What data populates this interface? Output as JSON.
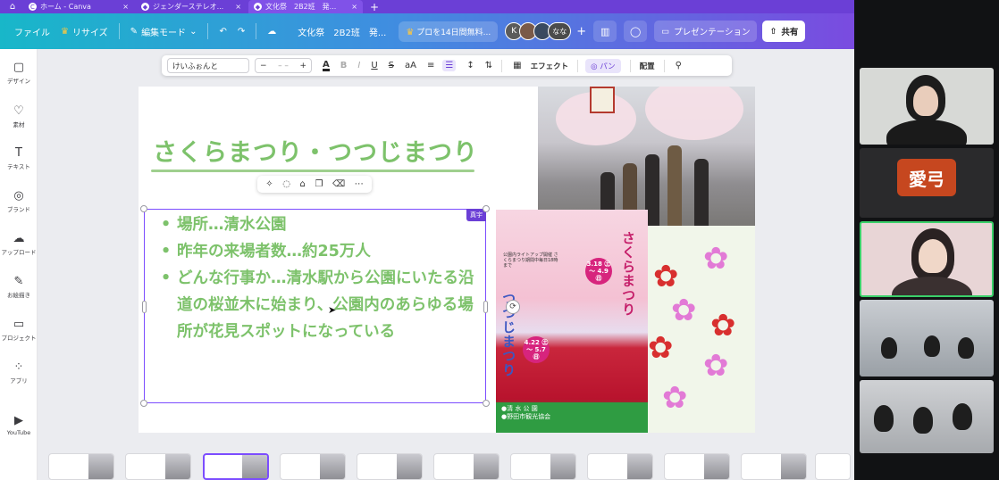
{
  "browser": {
    "tabs": [
      {
        "favicon": "C",
        "title": "ホーム - Canva",
        "active": false
      },
      {
        "favicon": "◆",
        "title": "ジェンダーステレオ...",
        "active": false
      },
      {
        "favicon": "◆",
        "title": "文化祭　2B2班　発...",
        "active": true
      }
    ],
    "new_tab": "+"
  },
  "header": {
    "file": "ファイル",
    "resize": "リサイズ",
    "edit_mode": "編集モード",
    "doc_title": "文化祭　2B2班　発...",
    "promo": "プロを14日間無料...",
    "avatar_k": "K",
    "avatar_nana": "なな",
    "add": "+",
    "presentation": "プレゼンテーション",
    "share": "共有"
  },
  "sidebar": {
    "items": [
      {
        "icon": "▢",
        "label": "デザイン"
      },
      {
        "icon": "♡",
        "label": "素材"
      },
      {
        "icon": "T",
        "label": "テキスト"
      },
      {
        "icon": "◎",
        "label": "ブランド"
      },
      {
        "icon": "☁",
        "label": "アップロード"
      },
      {
        "icon": "✎",
        "label": "お絵描き"
      },
      {
        "icon": "▭",
        "label": "プロジェクト"
      },
      {
        "icon": "⁘",
        "label": "アプリ"
      },
      {
        "icon": "▶",
        "label": "YouTube"
      }
    ]
  },
  "toolbar": {
    "font": "けいふぉんと",
    "minus": "−",
    "size": "– –",
    "plus": "+",
    "effects": "エフェクト",
    "pan": "パン",
    "arrange": "配置"
  },
  "slide": {
    "title": "さくらまつり・つつじまつり",
    "bullets": [
      "場所…清水公園",
      "昨年の来場者数…約25万人",
      "どんな行事か…清水駅から公園にいたる沿道の桜並木に始まり、公園内のあらゆる場所が花見スポットになっている"
    ],
    "textbox_label": "真宇",
    "poster": {
      "vertical_sakura": "さくらまつり",
      "vertical_tsutsuji": "つつじまつり",
      "badge1": "3.18 ㊏ 〜 4.9 ㊐",
      "badge2": "4.22 ㊏ 〜 5.7 ㊐",
      "small_text": "公園内ライトアップ開催 さくらまつり期間中毎日18時まで",
      "footer_line1": "●清 水 公 園",
      "footer_line2": "●野田市観光協会"
    }
  },
  "call": {
    "name_tile": "愛弓"
  },
  "colors": {
    "title_green": "#7dc26b",
    "selection_purple": "#7c4dff",
    "speaker_green": "#3bd06a",
    "name_tile_orange": "#c6471f"
  }
}
